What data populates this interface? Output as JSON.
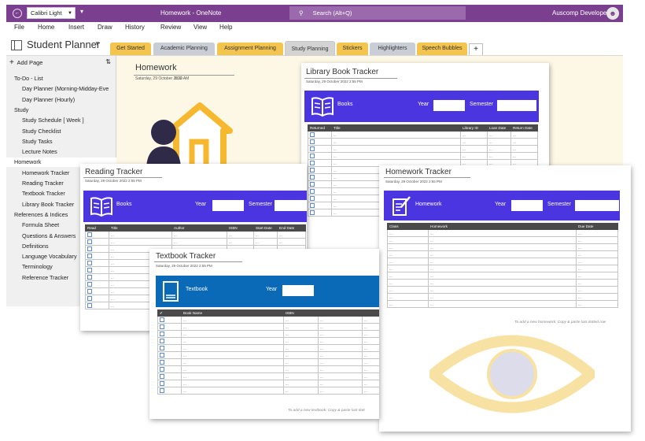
{
  "titlebar": {
    "font_name": "Calibri Light",
    "title": "Homework - OneNote",
    "search_placeholder": "Search (Alt+Q)",
    "user_name": "Auscomp Developer"
  },
  "menu": [
    "File",
    "Home",
    "Insert",
    "Draw",
    "History",
    "Review",
    "View",
    "Help"
  ],
  "notebook": {
    "name": "Student Planner",
    "sections": [
      {
        "label": "Get Started",
        "color": "#f3c44e"
      },
      {
        "label": "Academic Planning",
        "color": "#c9ced6"
      },
      {
        "label": "Assignment Planning",
        "color": "#f3c44e"
      },
      {
        "label": "Study Planning",
        "color": "#d3d3d3"
      },
      {
        "label": "Stickers",
        "color": "#f3c44e"
      },
      {
        "label": "Highlighters",
        "color": "#c9ced6"
      },
      {
        "label": "Speech Bubbles",
        "color": "#f3c44e"
      }
    ],
    "add_section": "+"
  },
  "sidebar": {
    "add_page": "Add Page",
    "pages": [
      {
        "label": "To-Do - List",
        "level": 1
      },
      {
        "label": "Day Planner (Morning-Midday-Eve",
        "level": 2
      },
      {
        "label": "Day Planner (Hourly)",
        "level": 2
      },
      {
        "label": "Study",
        "level": 1
      },
      {
        "label": "Study Schedule [ Week ]",
        "level": 2
      },
      {
        "label": "Study Checklist",
        "level": 2
      },
      {
        "label": "Study Tasks",
        "level": 2
      },
      {
        "label": "Lecture Notes",
        "level": 2
      },
      {
        "label": "Homework",
        "level": 1,
        "selected": true
      },
      {
        "label": "Homework Tracker",
        "level": 2
      },
      {
        "label": "Reading Tracker",
        "level": 2
      },
      {
        "label": "Textbook Tracker",
        "level": 2
      },
      {
        "label": "Library Book Tracker",
        "level": 2
      },
      {
        "label": "References & Indices",
        "level": 1
      },
      {
        "label": "Formula Sheet",
        "level": 2
      },
      {
        "label": "Questions & Answers",
        "level": 2
      },
      {
        "label": "Definitions",
        "level": 2
      },
      {
        "label": "Language Vocabulary",
        "level": 2
      },
      {
        "label": "Terminology",
        "level": 2
      },
      {
        "label": "Reference Tracker",
        "level": 2
      }
    ]
  },
  "homework_page": {
    "title": "Homework",
    "date": "Saturday, 29 October 2022",
    "time": "9:30 AM"
  },
  "library": {
    "title": "Library Book Tracker",
    "date": "Saturday, 29 October 2022     2:55 PM",
    "banner_label": "Books",
    "year_label": "Year",
    "semester_label": "Semester",
    "headers": [
      "Returned",
      "Title",
      "Library ID",
      "Loan Date",
      "Return Date"
    ],
    "row_value": "...",
    "row_count": 12,
    "color": "#4b35e0"
  },
  "reading": {
    "title": "Reading Tracker",
    "date": "Saturday, 29 October 2022     2:55 PM",
    "banner_label": "Books",
    "year_label": "Year",
    "semester_label": "Semester",
    "headers": [
      "Read",
      "Title",
      "Author",
      "ISBN",
      "Start Date",
      "End Date"
    ],
    "row_value": "...",
    "row_count": 11,
    "color": "#4b35e0"
  },
  "homework_tracker": {
    "title": "Homework Tracker",
    "date": "Saturday, 29 October 2022     2:55 PM",
    "banner_label": "Homework",
    "year_label": "Year",
    "semester_label": "Semester",
    "headers": [
      "Class",
      "Homework",
      "Due Date"
    ],
    "row_value": "...",
    "row_count": 11,
    "hint": "To add a new homework: Copy & paste last dotted row",
    "color": "#4b35e0"
  },
  "textbook": {
    "title": "Textbook Tracker",
    "date": "Saturday, 29 October 2022     2:55 PM",
    "banner_label": "Textbook",
    "year_label": "Year",
    "headers": [
      "✔",
      "Book Name",
      "ISBN",
      "",
      ""
    ],
    "row_value": "...",
    "row_count": 11,
    "hint": "To add a new textbook: Copy & paste last dott",
    "color": "#0a6ab8"
  }
}
